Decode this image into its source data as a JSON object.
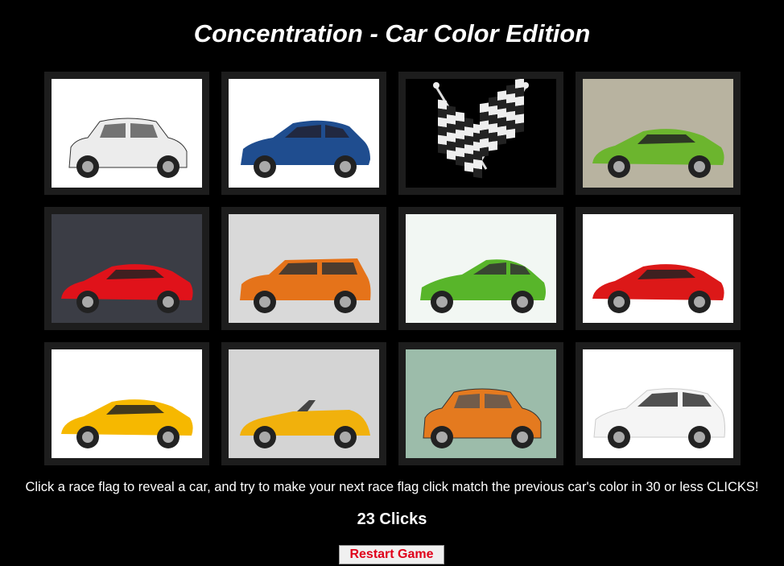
{
  "title": "Concentration - Car Color Edition",
  "instructions": "Click a race flag to reveal a car, and try to make your next race flag click match the previous car's color in 30 or less CLICKS!",
  "clicks": {
    "count": 23,
    "label": "23 Clicks"
  },
  "restart_label": "Restart Game",
  "cards": [
    {
      "state": "revealed",
      "content": "car",
      "color": "white",
      "icon": "classic-small-car-icon",
      "bg": "#ffffff",
      "body": "#ececec"
    },
    {
      "state": "revealed",
      "content": "car",
      "color": "blue",
      "icon": "hatchback-car-icon",
      "bg": "#ffffff",
      "body": "#1f4d8f"
    },
    {
      "state": "hidden",
      "content": "race-flag",
      "icon": "checkered-flags-icon",
      "bg": "#000000"
    },
    {
      "state": "revealed",
      "content": "car",
      "color": "green",
      "icon": "sports-car-icon",
      "bg": "#b8b3a0",
      "body": "#6cb52e"
    },
    {
      "state": "revealed",
      "content": "car",
      "color": "red",
      "icon": "sports-car-icon",
      "bg": "#3b3d45",
      "body": "#e0121a"
    },
    {
      "state": "revealed",
      "content": "car",
      "color": "orange",
      "icon": "wagon-car-icon",
      "bg": "#d9d9d9",
      "body": "#e5731a"
    },
    {
      "state": "revealed",
      "content": "car",
      "color": "green",
      "icon": "hybrid-car-icon",
      "bg": "#f2f7f3",
      "body": "#58b52a"
    },
    {
      "state": "revealed",
      "content": "car",
      "color": "red",
      "icon": "sports-car-icon",
      "bg": "#ffffff",
      "body": "#dc1818"
    },
    {
      "state": "revealed",
      "content": "car",
      "color": "yellow",
      "icon": "sports-car-icon",
      "bg": "#ffffff",
      "body": "#f6b800"
    },
    {
      "state": "revealed",
      "content": "car",
      "color": "yellow",
      "icon": "convertible-car-icon",
      "bg": "#d4d4d4",
      "body": "#f1b10c"
    },
    {
      "state": "revealed",
      "content": "car",
      "color": "orange",
      "icon": "classic-small-car-icon",
      "bg": "#9cbcaa",
      "body": "#e47a1f"
    },
    {
      "state": "revealed",
      "content": "car",
      "color": "white",
      "icon": "suv-car-icon",
      "bg": "#ffffff",
      "body": "#f5f5f5"
    }
  ]
}
